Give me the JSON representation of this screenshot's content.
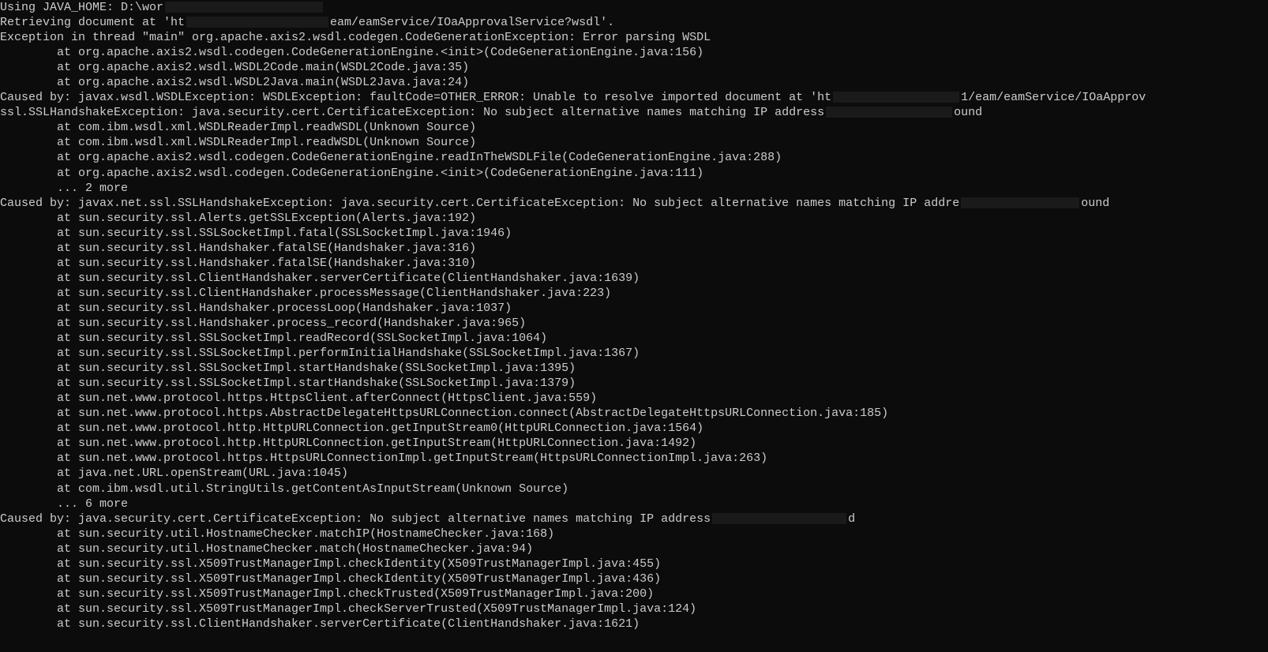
{
  "lines": [
    {
      "indent": 0,
      "text": "Using JAVA_HOME:   D:\\wor",
      "redacted_width": 200
    },
    {
      "indent": 0,
      "text": "Retrieving document at 'ht",
      "redacted_width": 180,
      "suffix": "eam/eamService/IOaApprovalService?wsdl'."
    },
    {
      "indent": 0,
      "text": "Exception in thread \"main\" org.apache.axis2.wsdl.codegen.CodeGenerationException: Error parsing WSDL"
    },
    {
      "indent": 1,
      "text": "at org.apache.axis2.wsdl.codegen.CodeGenerationEngine.<init>(CodeGenerationEngine.java:156)"
    },
    {
      "indent": 1,
      "text": "at org.apache.axis2.wsdl.WSDL2Code.main(WSDL2Code.java:35)"
    },
    {
      "indent": 1,
      "text": "at org.apache.axis2.wsdl.WSDL2Java.main(WSDL2Java.java:24)"
    },
    {
      "indent": 0,
      "text": "Caused by: javax.wsdl.WSDLException: WSDLException: faultCode=OTHER_ERROR: Unable to resolve imported document at 'ht",
      "redacted_width": 160,
      "suffix": "1/eam/eamService/IOaApprov"
    },
    {
      "indent": 0,
      "text": "ssl.SSLHandshakeException: java.security.cert.CertificateException: No subject alternative names matching IP address",
      "redacted_width": 160,
      "suffix": "ound"
    },
    {
      "indent": 1,
      "text": "at com.ibm.wsdl.xml.WSDLReaderImpl.readWSDL(Unknown Source)"
    },
    {
      "indent": 1,
      "text": "at com.ibm.wsdl.xml.WSDLReaderImpl.readWSDL(Unknown Source)"
    },
    {
      "indent": 1,
      "text": "at org.apache.axis2.wsdl.codegen.CodeGenerationEngine.readInTheWSDLFile(CodeGenerationEngine.java:288)"
    },
    {
      "indent": 1,
      "text": "at org.apache.axis2.wsdl.codegen.CodeGenerationEngine.<init>(CodeGenerationEngine.java:111)"
    },
    {
      "indent": 1,
      "text": "... 2 more"
    },
    {
      "indent": 0,
      "text": "Caused by: javax.net.ssl.SSLHandshakeException: java.security.cert.CertificateException: No subject alternative names matching IP addre",
      "redacted_width": 150,
      "suffix": "ound"
    },
    {
      "indent": 1,
      "text": "at sun.security.ssl.Alerts.getSSLException(Alerts.java:192)"
    },
    {
      "indent": 1,
      "text": "at sun.security.ssl.SSLSocketImpl.fatal(SSLSocketImpl.java:1946)"
    },
    {
      "indent": 1,
      "text": "at sun.security.ssl.Handshaker.fatalSE(Handshaker.java:316)"
    },
    {
      "indent": 1,
      "text": "at sun.security.ssl.Handshaker.fatalSE(Handshaker.java:310)"
    },
    {
      "indent": 1,
      "text": "at sun.security.ssl.ClientHandshaker.serverCertificate(ClientHandshaker.java:1639)"
    },
    {
      "indent": 1,
      "text": "at sun.security.ssl.ClientHandshaker.processMessage(ClientHandshaker.java:223)"
    },
    {
      "indent": 1,
      "text": "at sun.security.ssl.Handshaker.processLoop(Handshaker.java:1037)"
    },
    {
      "indent": 1,
      "text": "at sun.security.ssl.Handshaker.process_record(Handshaker.java:965)"
    },
    {
      "indent": 1,
      "text": "at sun.security.ssl.SSLSocketImpl.readRecord(SSLSocketImpl.java:1064)"
    },
    {
      "indent": 1,
      "text": "at sun.security.ssl.SSLSocketImpl.performInitialHandshake(SSLSocketImpl.java:1367)"
    },
    {
      "indent": 1,
      "text": "at sun.security.ssl.SSLSocketImpl.startHandshake(SSLSocketImpl.java:1395)"
    },
    {
      "indent": 1,
      "text": "at sun.security.ssl.SSLSocketImpl.startHandshake(SSLSocketImpl.java:1379)"
    },
    {
      "indent": 1,
      "text": "at sun.net.www.protocol.https.HttpsClient.afterConnect(HttpsClient.java:559)"
    },
    {
      "indent": 1,
      "text": "at sun.net.www.protocol.https.AbstractDelegateHttpsURLConnection.connect(AbstractDelegateHttpsURLConnection.java:185)"
    },
    {
      "indent": 1,
      "text": "at sun.net.www.protocol.http.HttpURLConnection.getInputStream0(HttpURLConnection.java:1564)"
    },
    {
      "indent": 1,
      "text": "at sun.net.www.protocol.http.HttpURLConnection.getInputStream(HttpURLConnection.java:1492)"
    },
    {
      "indent": 1,
      "text": "at sun.net.www.protocol.https.HttpsURLConnectionImpl.getInputStream(HttpsURLConnectionImpl.java:263)"
    },
    {
      "indent": 1,
      "text": "at java.net.URL.openStream(URL.java:1045)"
    },
    {
      "indent": 1,
      "text": "at com.ibm.wsdl.util.StringUtils.getContentAsInputStream(Unknown Source)"
    },
    {
      "indent": 1,
      "text": "... 6 more"
    },
    {
      "indent": 0,
      "text": "Caused by: java.security.cert.CertificateException: No subject alternative names matching IP address",
      "redacted_width": 170,
      "suffix": "d"
    },
    {
      "indent": 1,
      "text": "at sun.security.util.HostnameChecker.matchIP(HostnameChecker.java:168)"
    },
    {
      "indent": 1,
      "text": "at sun.security.util.HostnameChecker.match(HostnameChecker.java:94)"
    },
    {
      "indent": 1,
      "text": "at sun.security.ssl.X509TrustManagerImpl.checkIdentity(X509TrustManagerImpl.java:455)"
    },
    {
      "indent": 1,
      "text": "at sun.security.ssl.X509TrustManagerImpl.checkIdentity(X509TrustManagerImpl.java:436)"
    },
    {
      "indent": 1,
      "text": "at sun.security.ssl.X509TrustManagerImpl.checkTrusted(X509TrustManagerImpl.java:200)"
    },
    {
      "indent": 1,
      "text": "at sun.security.ssl.X509TrustManagerImpl.checkServerTrusted(X509TrustManagerImpl.java:124)"
    },
    {
      "indent": 1,
      "text": "at sun.security.ssl.ClientHandshaker.serverCertificate(ClientHandshaker.java:1621)"
    }
  ]
}
